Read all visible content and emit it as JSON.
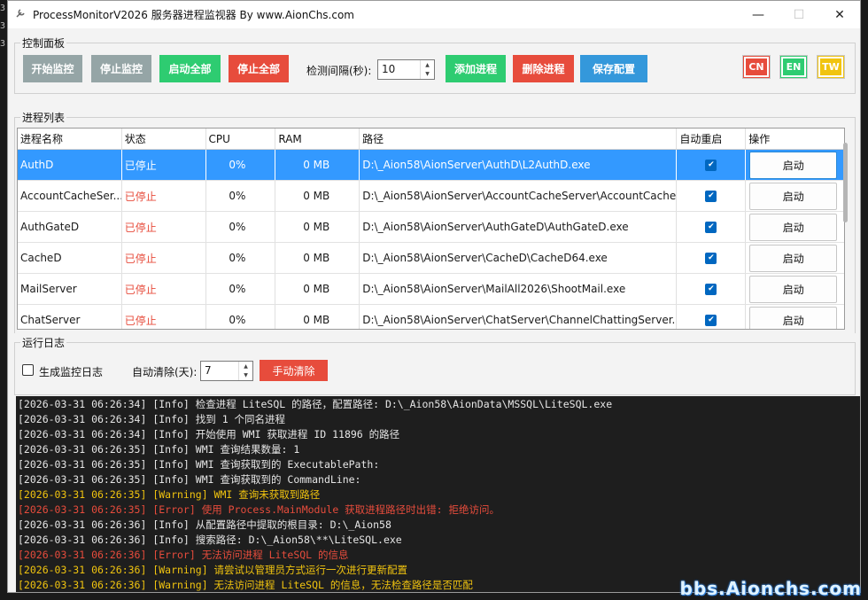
{
  "corner_glyphs": [
    "3",
    "3",
    "3"
  ],
  "window": {
    "title": "ProcessMonitorV2026 服务器进程监视器 By www.AionChs.com",
    "minimize": "—",
    "maximize": "☐",
    "close": "✕"
  },
  "control_panel": {
    "legend": "控制面板",
    "start_monitor": "开始监控",
    "stop_monitor": "停止监控",
    "start_all": "启动全部",
    "stop_all": "停止全部",
    "interval_label": "检测间隔(秒):",
    "interval_value": "10",
    "add_process": "添加进程",
    "delete_process": "删除进程",
    "save_config": "保存配置",
    "lang_cn": "CN",
    "lang_en": "EN",
    "lang_tw": "TW"
  },
  "process_list": {
    "legend": "进程列表",
    "columns": {
      "name": "进程名称",
      "status": "状态",
      "cpu": "CPU",
      "ram": "RAM",
      "path": "路径",
      "auto_restart": "自动重启",
      "action": "操作"
    },
    "rows": [
      {
        "name": "AuthD",
        "status": "已停止",
        "cpu": "0%",
        "ram": "0 MB",
        "path": "D:\\_Aion58\\AionServer\\AuthD\\L2AuthD.exe",
        "action": "启动"
      },
      {
        "name": "AccountCacheSer...",
        "status": "已停止",
        "cpu": "0%",
        "ram": "0 MB",
        "path": "D:\\_Aion58\\AionServer\\AccountCacheServer\\AccountCache...",
        "action": "启动"
      },
      {
        "name": "AuthGateD",
        "status": "已停止",
        "cpu": "0%",
        "ram": "0 MB",
        "path": "D:\\_Aion58\\AionServer\\AuthGateD\\AuthGateD.exe",
        "action": "启动"
      },
      {
        "name": "CacheD",
        "status": "已停止",
        "cpu": "0%",
        "ram": "0 MB",
        "path": "D:\\_Aion58\\AionServer\\CacheD\\CacheD64.exe",
        "action": "启动"
      },
      {
        "name": "MailServer",
        "status": "已停止",
        "cpu": "0%",
        "ram": "0 MB",
        "path": "D:\\_Aion58\\AionServer\\MailAll2026\\ShootMail.exe",
        "action": "启动"
      },
      {
        "name": "ChatServer",
        "status": "已停止",
        "cpu": "0%",
        "ram": "0 MB",
        "path": "D:\\_Aion58\\AionServer\\ChatServer\\ChannelChattingServer....",
        "action": "启动"
      }
    ]
  },
  "run_log": {
    "legend": "运行日志",
    "generate_log_label": "生成监控日志",
    "auto_clear_label": "自动清除(天):",
    "auto_clear_value": "7",
    "manual_clear": "手动清除",
    "lines": [
      {
        "level": "info",
        "text": "[2026-03-31 06:26:34] [Info] 检查进程 LiteSQL 的路径，配置路径: D:\\_Aion58\\AionData\\MSSQL\\LiteSQL.exe"
      },
      {
        "level": "info",
        "text": "[2026-03-31 06:26:34] [Info] 找到 1 个同名进程"
      },
      {
        "level": "info",
        "text": "[2026-03-31 06:26:34] [Info] 开始使用 WMI 获取进程 ID 11896 的路径"
      },
      {
        "level": "info",
        "text": "[2026-03-31 06:26:35] [Info] WMI 查询结果数量: 1"
      },
      {
        "level": "info",
        "text": "[2026-03-31 06:26:35] [Info] WMI 查询获取到的 ExecutablePath:"
      },
      {
        "level": "info",
        "text": "[2026-03-31 06:26:35] [Info] WMI 查询获取到的 CommandLine:"
      },
      {
        "level": "warning",
        "text": "[2026-03-31 06:26:35] [Warning] WMI 查询未获取到路径"
      },
      {
        "level": "error",
        "text": "[2026-03-31 06:26:35] [Error] 使用 Process.MainModule 获取进程路径时出错: 拒绝访问。"
      },
      {
        "level": "info",
        "text": "[2026-03-31 06:26:36] [Info] 从配置路径中提取的根目录: D:\\_Aion58"
      },
      {
        "level": "info",
        "text": "[2026-03-31 06:26:36] [Info] 搜索路径: D:\\_Aion58\\**\\LiteSQL.exe"
      },
      {
        "level": "error",
        "text": "[2026-03-31 06:26:36] [Error] 无法访问进程 LiteSQL 的信息"
      },
      {
        "level": "warning",
        "text": "[2026-03-31 06:26:36] [Warning] 请尝试以管理员方式运行一次进行更新配置"
      },
      {
        "level": "warning",
        "text": "[2026-03-31 06:26:36] [Warning] 无法访问进程 LiteSQL 的信息，无法检查路径是否匹配"
      }
    ]
  },
  "watermark": "bbs.Aionchs.com",
  "colors": {
    "selected_row": "#3399ff",
    "stopped": "#e74c3c",
    "log_bg": "#1e1e1e"
  }
}
